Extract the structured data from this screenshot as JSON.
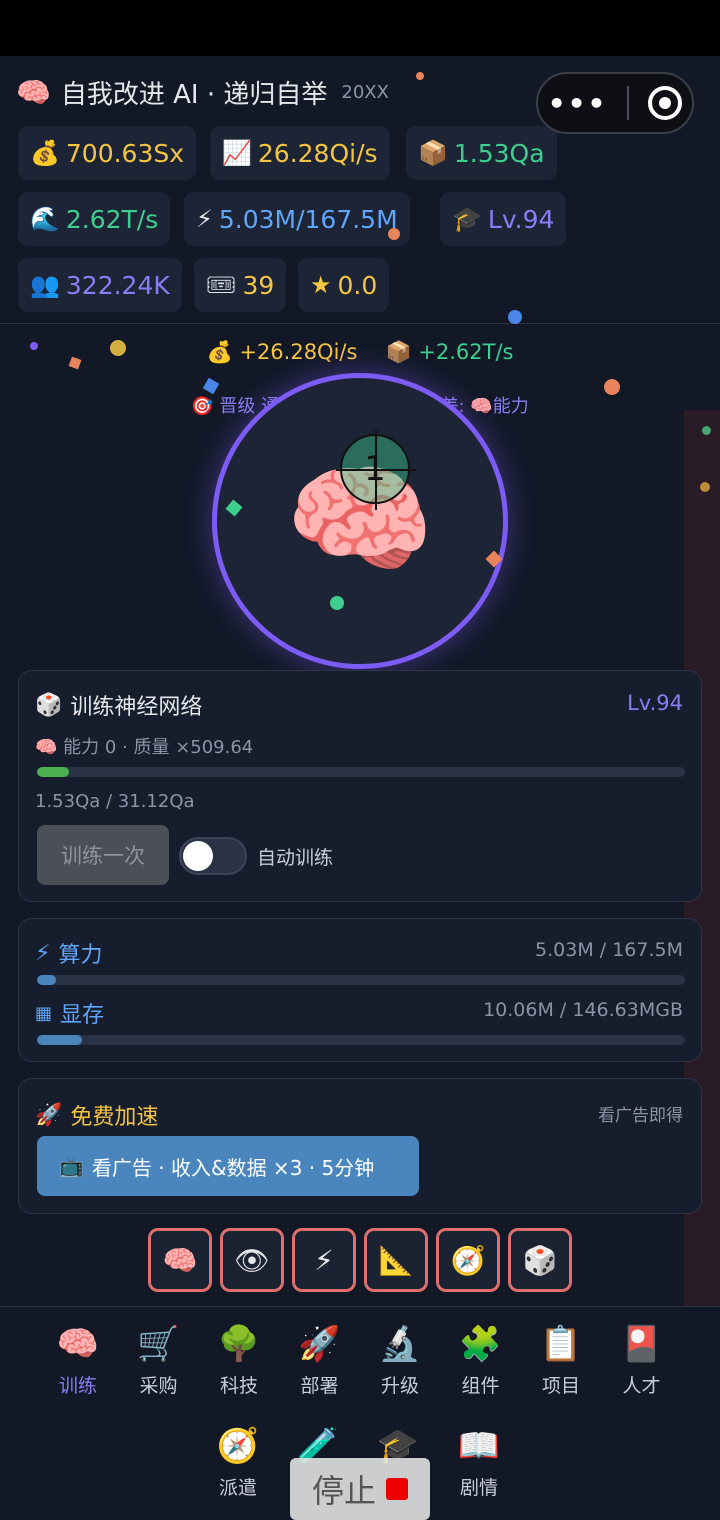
{
  "header": {
    "icon": "brain-icon",
    "title": "自我改进 AI · 递归自举",
    "subtitle": "20XX"
  },
  "stats": [
    {
      "id": "money",
      "icon": "money-bag-icon",
      "glyph": "💰",
      "value": "700.63Sx",
      "color": "#f5c542"
    },
    {
      "id": "income",
      "icon": "chart-up-icon",
      "glyph": "📈",
      "value": "26.28Qi/s",
      "color": "#f5c542"
    },
    {
      "id": "data",
      "icon": "package-icon",
      "glyph": "📦",
      "value": "1.53Qa",
      "color": "#3ecf8e"
    },
    {
      "id": "datarate",
      "icon": "wave-icon",
      "glyph": "🌊",
      "value": "2.62T/s",
      "color": "#3ecf8e"
    },
    {
      "id": "compute",
      "icon": "lightning-icon",
      "glyph": "⚡",
      "value": "5.03M/167.5M",
      "color": "#60a5fa"
    },
    {
      "id": "level",
      "icon": "graduation-cap-icon",
      "glyph": "🎓",
      "value": "Lv.94",
      "color": "#8b7cf6"
    },
    {
      "id": "users",
      "icon": "users-icon",
      "glyph": "👥",
      "value": "322.24K",
      "color": "#8b7cf6"
    },
    {
      "id": "tickets",
      "icon": "ticket-icon",
      "glyph": "🎟",
      "value": "39",
      "color": "#f5c542"
    },
    {
      "id": "stars",
      "icon": "star-icon",
      "glyph": "★",
      "value": "0.0",
      "color": "#f5c542"
    }
  ],
  "capsule": {
    "more": "•••",
    "close_icon": "target-icon"
  },
  "rates": {
    "money_rate": "+26.28Qi/s",
    "data_rate": "+2.62T/s"
  },
  "goal": {
    "prefix": "🎯 晋级 通",
    "suffix": "差: 🧠能力"
  },
  "clicker": {
    "combo": "1",
    "icon": "brain-icon"
  },
  "train": {
    "title": "训练神经网络",
    "level": "Lv.94",
    "stats_line": "🧠 能力 0 · 质量 ×509.64",
    "progress_text": "1.53Qa / 31.12Qa",
    "progress_fraction": 0.049,
    "button": "训练一次",
    "auto_label": "自动训练",
    "auto_on": false
  },
  "resources": {
    "compute_label": "算力",
    "compute_value": "5.03M / 167.5M",
    "compute_fraction": 0.03,
    "memory_label": "显存",
    "memory_value": "10.06M / 146.63MGB",
    "memory_fraction": 0.069
  },
  "boost": {
    "title": "免费加速",
    "hint": "看广告即得",
    "button": "看广告 · 收入&数据 ×3 · 5分钟"
  },
  "quick": [
    {
      "icon": "brain-icon",
      "glyph": "🧠"
    },
    {
      "icon": "eye-icon",
      "glyph": "👁"
    },
    {
      "icon": "lightning-icon",
      "glyph": "⚡"
    },
    {
      "icon": "triangle-ruler-icon",
      "glyph": "📐"
    },
    {
      "icon": "compass-icon",
      "glyph": "🧭"
    },
    {
      "icon": "dice-icon",
      "glyph": "🎲"
    }
  ],
  "nav": [
    {
      "label": "训练",
      "icon": "brain-icon",
      "glyph": "🧠",
      "active": true
    },
    {
      "label": "采购",
      "icon": "cart-icon",
      "glyph": "🛒"
    },
    {
      "label": "科技",
      "icon": "tree-icon",
      "glyph": "🌳"
    },
    {
      "label": "部署",
      "icon": "rocket-icon",
      "glyph": "🚀"
    },
    {
      "label": "升级",
      "icon": "microscope-icon",
      "glyph": "🔬"
    },
    {
      "label": "组件",
      "icon": "puzzle-icon",
      "glyph": "🧩"
    },
    {
      "label": "项目",
      "icon": "clipboard-icon",
      "glyph": "📋"
    },
    {
      "label": "人才",
      "icon": "card-icon",
      "glyph": "🎴"
    },
    {
      "label": "派遣",
      "icon": "compass-icon",
      "glyph": "🧭"
    },
    {
      "label": "",
      "icon": "scientist-icon",
      "glyph": "🧪"
    },
    {
      "label": "",
      "icon": "graduation-cap-icon",
      "glyph": "🎓"
    },
    {
      "label": "剧情",
      "icon": "book-icon",
      "glyph": "📖"
    }
  ],
  "stop": {
    "label": "停止"
  }
}
